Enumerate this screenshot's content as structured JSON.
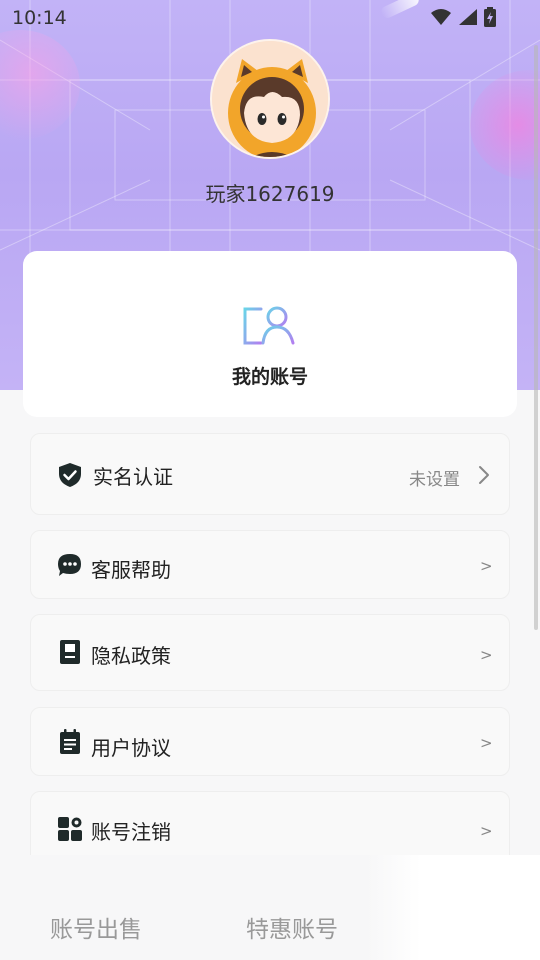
{
  "status_bar": {
    "time": "10:14"
  },
  "profile": {
    "username": "玩家1627619"
  },
  "account_card": {
    "label": "我的账号"
  },
  "menu": [
    {
      "label": "实名认证",
      "value": "未设置",
      "arrow": "〉",
      "icon": "shield-check-icon"
    },
    {
      "label": "客服帮助",
      "value": "",
      "arrow": ">",
      "icon": "chat-bubble-icon"
    },
    {
      "label": "隐私政策",
      "value": "",
      "arrow": ">",
      "icon": "policy-book-icon"
    },
    {
      "label": "用户协议",
      "value": "",
      "arrow": ">",
      "icon": "notepad-icon"
    },
    {
      "label": "账号注销",
      "value": "",
      "arrow": ">",
      "icon": "apps-gear-icon"
    }
  ],
  "bottom_tabs": [
    {
      "label": "账号出售"
    },
    {
      "label": "特惠账号"
    }
  ],
  "colors": {
    "header": "#c2b3f7",
    "icon_dark": "#1f2a2a",
    "text_muted": "#888888"
  }
}
